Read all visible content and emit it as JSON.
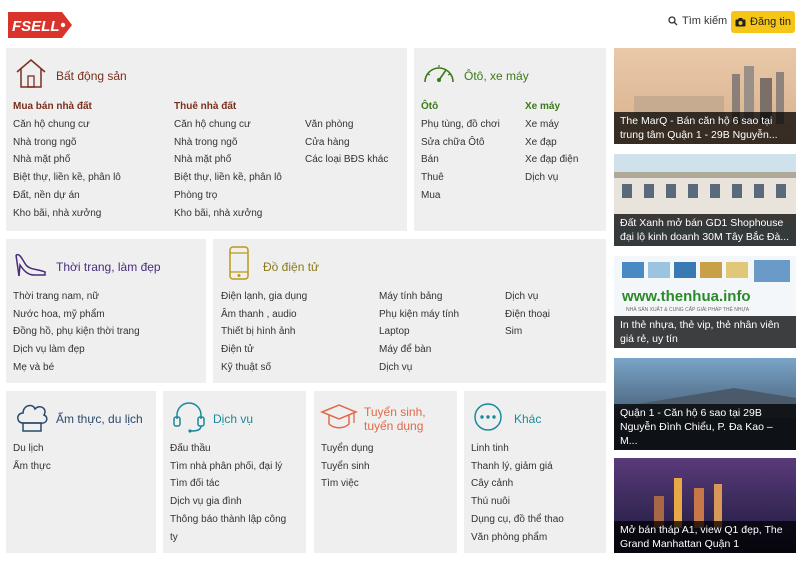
{
  "header": {
    "logo_text": "FSELL",
    "search_label": "Tìm kiếm",
    "post_label": "Đăng tin"
  },
  "colors": {
    "accent_yellow": "#f5c518",
    "logo_red": "#d9342b",
    "panel_bg": "#efefef"
  },
  "panels": {
    "bds": {
      "title": "Bất động sản",
      "icon": "house-icon",
      "cols": [
        {
          "head": "Mua bán nhà đất",
          "items": [
            "Căn hộ chung cư",
            "Nhà trong ngõ",
            "Nhà mặt phố",
            "Biệt thự, liền kề, phân lô",
            "Đất, nền dự án",
            "Kho bãi, nhà xưởng"
          ]
        },
        {
          "head": "Thuê nhà đất",
          "items": [
            "Căn hộ chung cư",
            "Nhà trong ngõ",
            "Nhà mặt phố",
            "Biệt thự, liền kề, phân lô",
            "Phòng trọ",
            "Kho bãi, nhà xưởng"
          ]
        },
        {
          "head": "",
          "items": [
            "Văn phòng",
            "Cửa hàng",
            "Các loại BĐS khác"
          ]
        }
      ]
    },
    "oto": {
      "title": "Ôtô, xe máy",
      "icon": "speedometer-icon",
      "cols": [
        {
          "head": "Ôtô",
          "items": [
            "Phụ tùng, đồ chơi",
            "Sửa chữa Ôtô",
            "Bán",
            "Thuê",
            "Mua"
          ]
        },
        {
          "head": "Xe máy",
          "items": [
            "Xe máy",
            "Xe đạp",
            "Xe đạp điện",
            "Dịch vụ"
          ]
        }
      ]
    },
    "tt": {
      "title": "Thời trang, làm đẹp",
      "icon": "high-heel-icon",
      "items": [
        "Thời trang nam, nữ",
        "Nước hoa, mỹ phẩm",
        "Đồng hồ, phụ kiện thời trang",
        "Dịch vụ làm đẹp",
        "Mẹ và bé"
      ]
    },
    "dt": {
      "title": "Đồ điện tử",
      "icon": "smartphone-icon",
      "cols": [
        {
          "items": [
            "Điện lạnh, gia dụng",
            "Âm thanh , audio",
            "Thiết bị hình ảnh",
            "Điện tử",
            "Kỹ thuật số"
          ]
        },
        {
          "items": [
            "Máy tính bảng",
            "Phụ kiện máy tính",
            "Laptop",
            "Máy để bàn",
            "Dịch vụ"
          ]
        },
        {
          "items": [
            "Dịch vụ",
            "Điện thoại",
            "Sim"
          ]
        }
      ]
    },
    "at": {
      "title": "Ẩm thực, du lịch",
      "icon": "chef-hat-icon",
      "items": [
        "Du lịch",
        "Ẩm thực"
      ]
    },
    "dv": {
      "title": "Dịch vụ",
      "icon": "headset-icon",
      "items": [
        "Đấu thầu",
        "Tìm nhà phân phối, đại lý",
        "Tìm đối tác",
        "Dịch vụ gia đình",
        "Thông báo thành lập công",
        "ty"
      ]
    },
    "ts": {
      "title_line1": "Tuyển sinh,",
      "title_line2": "tuyển dụng",
      "icon": "graduation-cap-icon",
      "items": [
        "Tuyển dụng",
        "Tuyển sinh",
        "Tìm việc"
      ]
    },
    "kh": {
      "title": "Khác",
      "icon": "more-dots-icon",
      "items": [
        "Linh tinh",
        "Thanh lý, giảm giá",
        "Cây cảnh",
        "Thú nuôi",
        "Dụng cụ, đồ thể thao",
        "Văn phòng phẩm"
      ]
    }
  },
  "ads": [
    {
      "caption": "The MarQ - Bán căn hộ 6 sao tại trung tâm Quận 1 - 29B Nguyễn..."
    },
    {
      "caption": "Đất Xanh mở bán GD1 Shophouse đại lộ kinh doanh 30M Tây Bắc Đà..."
    },
    {
      "banner_text": "www.thenhua.info",
      "banner_sub": "NHÀ SẢN XUẤT & CUNG CẤP GIẢI PHÁP THẺ NHỰA",
      "caption": "In thẻ nhựa, thẻ vip, thẻ nhân viên giá rẻ, uy tín"
    },
    {
      "caption": "Quận 1 - Căn hộ 6 sao tại 29B Nguyễn Đình Chiểu, P. Đa Kao – M..."
    },
    {
      "caption": "Mở bán tháp A1, view Q1 đẹp, The Grand Manhattan Quận 1"
    }
  ]
}
